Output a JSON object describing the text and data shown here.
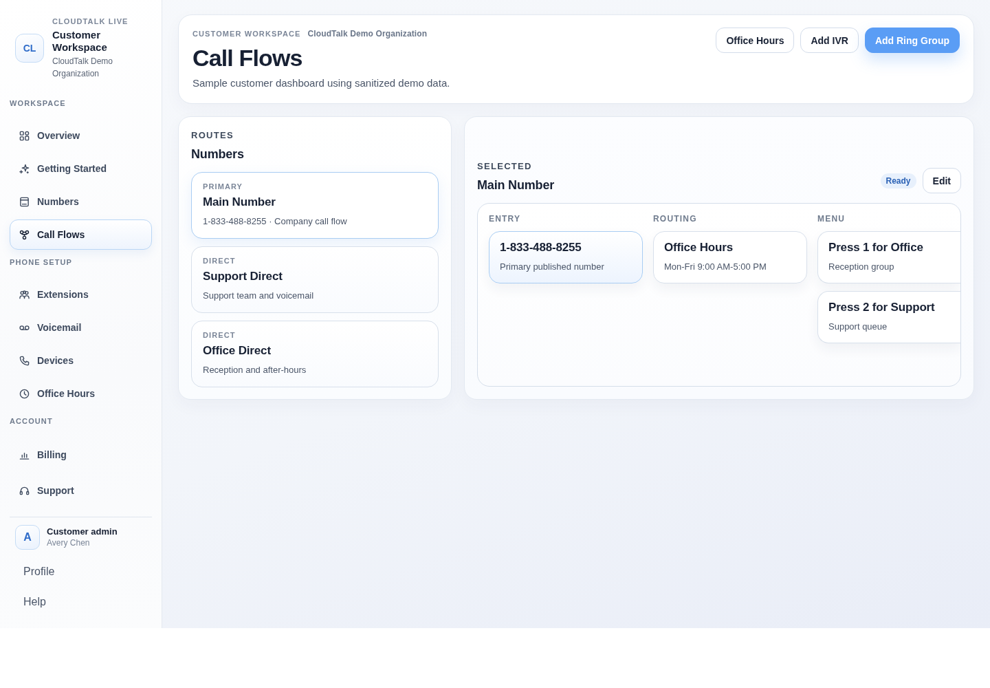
{
  "sidebar": {
    "brand": {
      "logo": "CL",
      "eyebrow": "CLOUDTALK LIVE",
      "title": "Customer Workspace",
      "subtitle": "CloudTalk Demo Organization"
    },
    "sections": [
      {
        "label": "WORKSPACE",
        "items": [
          {
            "label": "Overview",
            "selected": false
          },
          {
            "label": "Getting Started",
            "selected": false
          },
          {
            "label": "Numbers",
            "selected": false
          },
          {
            "label": "Call Flows",
            "selected": true
          }
        ]
      },
      {
        "label": "PHONE SETUP",
        "items": [
          {
            "label": "Extensions",
            "selected": false
          },
          {
            "label": "Voicemail",
            "selected": false
          },
          {
            "label": "Devices",
            "selected": false
          },
          {
            "label": "Office Hours",
            "selected": false
          }
        ]
      },
      {
        "label": "ACCOUNT",
        "items": [
          {
            "label": "Billing",
            "selected": false
          },
          {
            "label": "Support",
            "selected": false
          }
        ]
      }
    ],
    "user": {
      "avatar": "A",
      "role": "Customer admin",
      "name": "Avery Chen"
    },
    "links": [
      "Profile",
      "Help"
    ]
  },
  "header": {
    "eyebrow": "CUSTOMER WORKSPACE",
    "organization": "CloudTalk Demo Organization",
    "title": "Call Flows",
    "subtitle": "Sample customer dashboard using sanitized demo data.",
    "buttons": [
      {
        "label": "Office Hours",
        "kind": "outline"
      },
      {
        "label": "Add IVR",
        "kind": "outline"
      },
      {
        "label": "Add Ring Group",
        "kind": "primary"
      }
    ]
  },
  "routes": {
    "eyebrow": "ROUTES",
    "title": "Numbers",
    "items": [
      {
        "type": "PRIMARY",
        "name": "Main Number",
        "description": "1-833-488-8255 · Company call flow",
        "selected": true
      },
      {
        "type": "DIRECT",
        "name": "Support Direct",
        "description": "Support team and voicemail",
        "selected": false
      },
      {
        "type": "DIRECT",
        "name": "Office Direct",
        "description": "Reception and after-hours",
        "selected": false
      }
    ]
  },
  "detail": {
    "eyebrow": "SELECTED",
    "title": "Main Number",
    "status": "Ready",
    "edit_button": "Edit",
    "columns": [
      {
        "label": "ENTRY",
        "nodes": [
          {
            "title": "1-833-488-8255",
            "description": "Primary published number",
            "selected": true
          }
        ]
      },
      {
        "label": "ROUTING",
        "nodes": [
          {
            "title": "Office Hours",
            "description": "Mon-Fri 9:00 AM-5:00 PM",
            "selected": false
          }
        ]
      },
      {
        "label": "MENU",
        "nodes": [
          {
            "title": "Press 1 for Office",
            "description": "Reception group",
            "selected": false
          },
          {
            "title": "Press 2 for Support",
            "description": "Support queue",
            "selected": false
          }
        ]
      }
    ]
  }
}
